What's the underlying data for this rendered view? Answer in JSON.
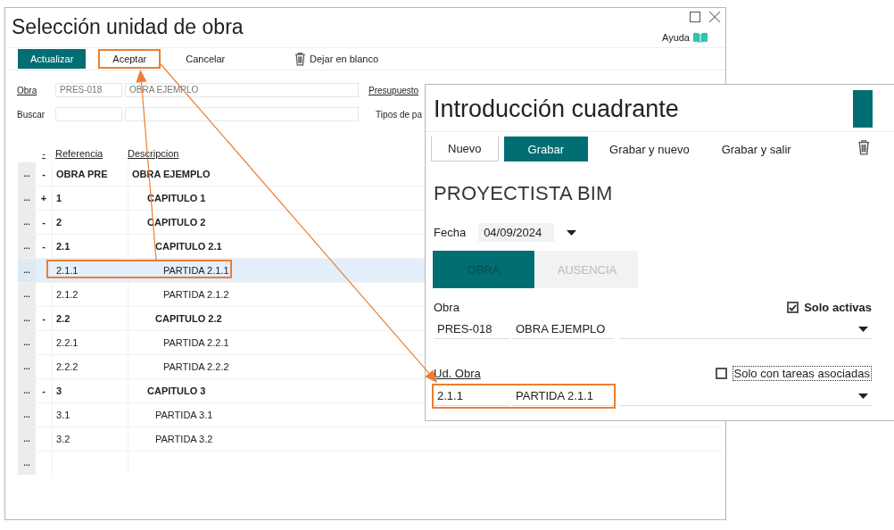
{
  "selection_window": {
    "title": "Selección unidad de obra",
    "help": "Ayuda",
    "toolbar": [
      {
        "label": "Actualizar",
        "kind": "primary",
        "highlighted": false
      },
      {
        "label": "Aceptar",
        "kind": "plain",
        "highlighted": true
      },
      {
        "label": "Cancelar",
        "kind": "plain",
        "highlighted": false
      },
      {
        "label": "Dejar en blanco",
        "kind": "trash",
        "highlighted": false
      }
    ],
    "filters": {
      "obra_label": "Obra",
      "obra_code": "PRES-018",
      "obra_name": "OBRA EJEMPLO",
      "presupuesto_label": "Presupuesto",
      "buscar_label": "Buscar",
      "tipos_label": "Tipos de pa"
    },
    "grid": {
      "columns": [
        "-",
        "Referencia",
        "Descripcion"
      ],
      "empty_row_handle": "...",
      "rows": [
        {
          "handle": "...",
          "toggle": "-",
          "ref": "OBRA PRE",
          "desc": "OBRA EJEMPLO",
          "kind": "chapter",
          "selected": false,
          "children": [
            {
              "handle": "...",
              "toggle": "+",
              "ref": "1",
              "desc": "CAPITULO 1",
              "kind": "chapter",
              "selected": false
            },
            {
              "handle": "...",
              "toggle": "-",
              "ref": "2",
              "desc": "CAPITULO 2",
              "kind": "chapter",
              "selected": false,
              "children": [
                {
                  "handle": "...",
                  "toggle": "-",
                  "ref": "2.1",
                  "desc": "CAPITULO 2.1",
                  "kind": "chapter",
                  "selected": false,
                  "children": [
                    {
                      "handle": "...",
                      "ref": "2.1.1",
                      "desc": "PARTIDA 2.1.1",
                      "kind": "item",
                      "selected": true
                    },
                    {
                      "handle": "...",
                      "ref": "2.1.2",
                      "desc": "PARTIDA 2.1.2",
                      "kind": "item",
                      "selected": false
                    }
                  ]
                },
                {
                  "handle": "...",
                  "toggle": "-",
                  "ref": "2.2",
                  "desc": "CAPITULO 2.2",
                  "kind": "chapter",
                  "selected": false,
                  "children": [
                    {
                      "handle": "...",
                      "ref": "2.2.1",
                      "desc": "PARTIDA 2.2.1",
                      "kind": "item",
                      "selected": false
                    },
                    {
                      "handle": "...",
                      "ref": "2.2.2",
                      "desc": "PARTIDA 2.2.2",
                      "kind": "item",
                      "selected": false
                    }
                  ]
                }
              ]
            },
            {
              "handle": "...",
              "toggle": "-",
              "ref": "3",
              "desc": "CAPITULO 3",
              "kind": "chapter",
              "selected": false,
              "children": [
                {
                  "handle": "...",
                  "ref": "3.1",
                  "desc": "PARTIDA 3.1",
                  "kind": "item",
                  "selected": false
                },
                {
                  "handle": "...",
                  "ref": "3.2",
                  "desc": "PARTIDA 3.2",
                  "kind": "item",
                  "selected": false
                }
              ]
            }
          ]
        }
      ]
    }
  },
  "entry_dialog": {
    "title": "Introducción cuadrante",
    "toolbar": [
      {
        "label": "Nuevo",
        "kind": "outlined"
      },
      {
        "label": "Grabar",
        "kind": "primary"
      },
      {
        "label": "Grabar y nuevo",
        "kind": "plain"
      },
      {
        "label": "Grabar y salir",
        "kind": "plain"
      }
    ],
    "heading": "PROYECTISTA BIM",
    "fecha_label": "Fecha",
    "fecha": "04/09/2024",
    "tabs": [
      {
        "label": "OBRA",
        "selected": true
      },
      {
        "label": "AUSENCIA",
        "selected": false
      }
    ],
    "obra": {
      "label": "Obra",
      "checkbox": {
        "label": "Solo activas",
        "checked": true
      },
      "code": "PRES-018",
      "name": "OBRA EJEMPLO"
    },
    "ud_obra": {
      "label": "Ud. Obra",
      "checkbox": {
        "label": "Solo con tareas asociadas",
        "checked": false
      },
      "code": "2.1.1",
      "name": "PARTIDA 2.1.1",
      "highlighted": true
    }
  }
}
